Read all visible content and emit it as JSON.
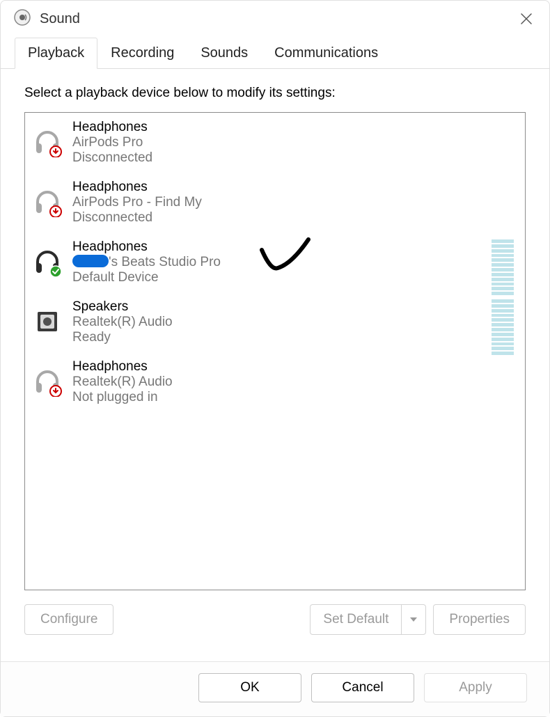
{
  "window": {
    "title": "Sound"
  },
  "tabs": [
    {
      "label": "Playback",
      "active": true
    },
    {
      "label": "Recording",
      "active": false
    },
    {
      "label": "Sounds",
      "active": false
    },
    {
      "label": "Communications",
      "active": false
    }
  ],
  "instruction": "Select a playback device below to modify its settings:",
  "devices": [
    {
      "name": "Headphones",
      "subtitle": "AirPods Pro",
      "status": "Disconnected",
      "icon": "headphones-disconnected",
      "meter": false
    },
    {
      "name": "Headphones",
      "subtitle": "AirPods Pro - Find My",
      "status": "Disconnected",
      "icon": "headphones-disconnected",
      "meter": false
    },
    {
      "name": "Headphones",
      "subtitle_suffix": "'s Beats Studio Pro",
      "subtitle_redacted": true,
      "status": "Default Device",
      "icon": "headphones-default",
      "meter": true,
      "annotated": true
    },
    {
      "name": "Speakers",
      "subtitle": "Realtek(R) Audio",
      "status": "Ready",
      "icon": "speakers",
      "meter": true
    },
    {
      "name": "Headphones",
      "subtitle": "Realtek(R) Audio",
      "status": "Not plugged in",
      "icon": "headphones-disconnected",
      "meter": false
    }
  ],
  "buttons": {
    "configure": "Configure",
    "set_default": "Set Default",
    "properties": "Properties",
    "ok": "OK",
    "cancel": "Cancel",
    "apply": "Apply"
  }
}
